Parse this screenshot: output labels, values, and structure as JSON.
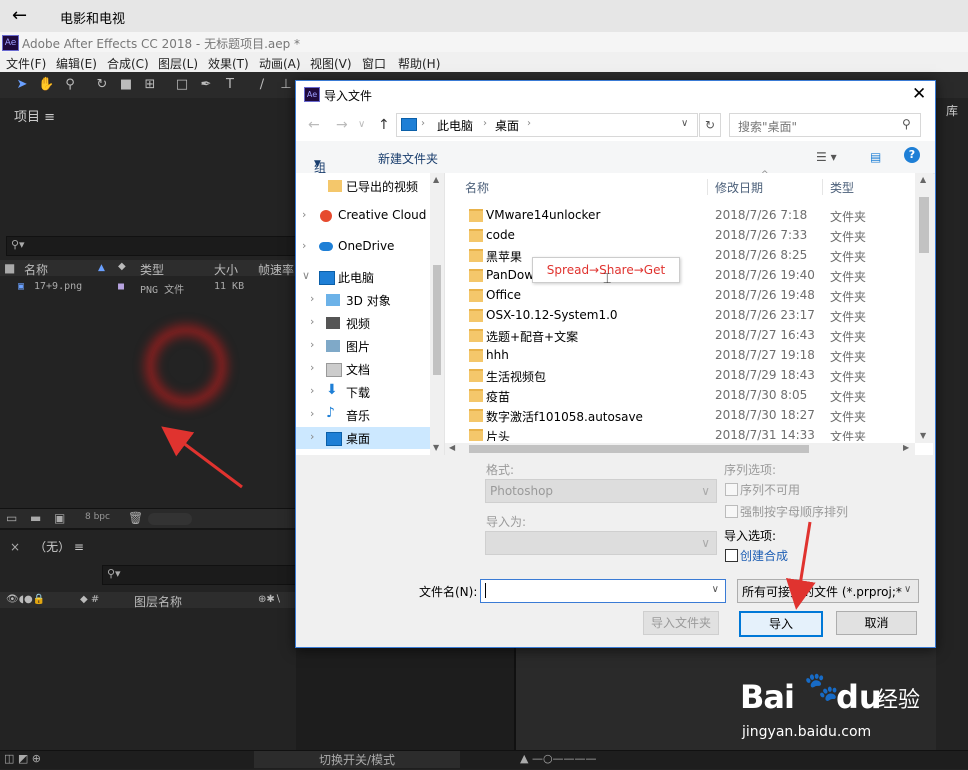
{
  "topbar": {
    "back": "←",
    "title": "电影和电视"
  },
  "ae": {
    "logo": "Ae",
    "window_title": "Adobe After Effects CC 2018 - 无标题项目.aep *",
    "menu": [
      "文件(F)",
      "编辑(E)",
      "合成(C)",
      "图层(L)",
      "效果(T)",
      "动画(A)",
      "视图(V)",
      "窗口",
      "帮助(H)"
    ]
  },
  "project": {
    "header": "项目",
    "menu_icon": "≡",
    "columns": [
      "名称",
      "类型",
      "大小",
      "帧速率"
    ],
    "file": {
      "name": "17+9.png",
      "type": "PNG 文件",
      "size": "11 KB"
    },
    "bpc": "8 bpc"
  },
  "timeline": {
    "none_label": "（无）",
    "columns": [
      "图层名称"
    ]
  },
  "right_panel": {
    "label": "库"
  },
  "statusbar": {
    "toggle_label": "切换开关/模式"
  },
  "dialog": {
    "title": "导入文件",
    "close": "✕",
    "path": [
      "此电脑",
      "桌面"
    ],
    "search_placeholder": "搜索\"桌面\"",
    "organize": "组织",
    "new_folder": "新建文件夹",
    "nav": [
      {
        "label": "已导出的视频",
        "icon": "folder"
      },
      {
        "label": "Creative Cloud F",
        "icon": "cloud-red"
      },
      {
        "label": "OneDrive",
        "icon": "cloud-blue"
      },
      {
        "label": "此电脑",
        "icon": "pc"
      },
      {
        "label": "3D 对象",
        "icon": "3d"
      },
      {
        "label": "视频",
        "icon": "video"
      },
      {
        "label": "图片",
        "icon": "picture"
      },
      {
        "label": "文档",
        "icon": "doc"
      },
      {
        "label": "下载",
        "icon": "download"
      },
      {
        "label": "音乐",
        "icon": "music"
      },
      {
        "label": "桌面",
        "icon": "desktop"
      }
    ],
    "columns": {
      "name": "名称",
      "date": "修改日期",
      "type": "类型"
    },
    "files": [
      {
        "name": "VMware14unlocker",
        "date": "2018/7/26 7:18",
        "type": "文件夹"
      },
      {
        "name": "code",
        "date": "2018/7/26 7:33",
        "type": "文件夹"
      },
      {
        "name": "黑苹果",
        "date": "2018/7/26 8:25",
        "type": "文件夹"
      },
      {
        "name": "PanDown",
        "date": "2018/7/26 19:40",
        "type": "文件夹"
      },
      {
        "name": "Office",
        "date": "2018/7/26 19:48",
        "type": "文件夹"
      },
      {
        "name": "OSX-10.12-System1.0",
        "date": "2018/7/26 23:17",
        "type": "文件夹"
      },
      {
        "name": "选题+配音+文案",
        "date": "2018/7/27 16:43",
        "type": "文件夹"
      },
      {
        "name": "hhh",
        "date": "2018/7/27 19:18",
        "type": "文件夹"
      },
      {
        "name": "生活视频包",
        "date": "2018/7/29 18:43",
        "type": "文件夹"
      },
      {
        "name": "疫苗",
        "date": "2018/7/30 8:05",
        "type": "文件夹"
      },
      {
        "name": "数字激活f101058.autosave",
        "date": "2018/7/30 18:27",
        "type": "文件夹"
      },
      {
        "name": "片头",
        "date": "2018/7/31 14:33",
        "type": "文件夹"
      }
    ],
    "tooltip": "Spread→Share→Get",
    "format_label": "格式:",
    "format_value": "Photoshop",
    "import_as_label": "导入为:",
    "sequence_label": "序列选项:",
    "seq_option1": "序列不可用",
    "seq_option2": "强制按字母顺序排列",
    "import_options_label": "导入选项:",
    "create_comp": "创建合成",
    "filename_label": "文件名(N):",
    "filename_value": "",
    "filetype": "所有可接受的文件 (*.prproj;*.c",
    "import_folder": "导入文件夹",
    "import": "导入",
    "cancel": "取消"
  },
  "watermark": {
    "brand": "Bai",
    "brand2": "du",
    "cn": "经验",
    "url": "jingyan.baidu.com"
  },
  "colors": {
    "accent": "#3a7bd5",
    "annotation": "#e0332f"
  }
}
